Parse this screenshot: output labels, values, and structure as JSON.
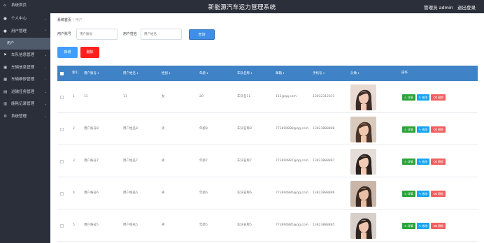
{
  "header": {
    "title": "新能源汽车运力管理系统",
    "user_label": "管理员 admin",
    "logout": "退出登录"
  },
  "sidebar": {
    "items": [
      {
        "icon": "home-icon",
        "label": "系统首页"
      },
      {
        "icon": "person-icon",
        "label": "个人中心"
      },
      {
        "icon": "users-icon",
        "label": "用户管理"
      },
      {
        "icon": "flag-icon",
        "label": "车队信息管理"
      },
      {
        "icon": "car-icon",
        "label": "车辆信息管理"
      },
      {
        "icon": "grid-icon",
        "label": "车辆维修管理"
      },
      {
        "icon": "doc-icon",
        "label": "运输任务管理"
      },
      {
        "icon": "battery-icon",
        "label": "能耗记录管理"
      },
      {
        "icon": "gear-icon",
        "label": "系统管理"
      }
    ],
    "subitem": "用户"
  },
  "breadcrumb": {
    "home": "系统首页",
    "current": "用户"
  },
  "search": {
    "label1": "用户账号",
    "placeholder1": "用户账号",
    "label2": "用户姓名",
    "placeholder2": "用户姓名",
    "query_button": "查询"
  },
  "actions": {
    "add": "新增",
    "delete": "删除"
  },
  "table": {
    "headers": [
      "索引",
      "用户账号",
      "用户姓名",
      "性别",
      "年龄",
      "车队名称",
      "邮箱",
      "手机号",
      "头像",
      "操作"
    ],
    "rows": [
      {
        "index": "1",
        "account": "11",
        "name": "11",
        "gender": "女",
        "age": "20",
        "team": "车队名11",
        "email": "111@qq.com",
        "phone": "13012312311"
      },
      {
        "index": "2",
        "account": "用户账号8",
        "name": "用户姓名8",
        "gender": "男",
        "age": "年龄8",
        "team": "车队名称8",
        "email": "773890888@qq.com",
        "phone": "13823888888"
      },
      {
        "index": "3",
        "account": "用户账号7",
        "name": "用户姓名7",
        "gender": "男",
        "age": "年龄7",
        "team": "车队名称7",
        "email": "773890887@qq.com",
        "phone": "13823888887"
      },
      {
        "index": "4",
        "account": "用户账号6",
        "name": "用户姓名6",
        "gender": "男",
        "age": "年龄6",
        "team": "车队名称6",
        "email": "773890886@qq.com",
        "phone": "13823888886"
      },
      {
        "index": "5",
        "account": "用户账号5",
        "name": "用户姓名5",
        "gender": "男",
        "age": "年龄5",
        "team": "车队名称5",
        "email": "773890885@qq.com",
        "phone": "13823888885"
      }
    ],
    "ops": {
      "detail": "详情",
      "edit": "修改",
      "delete": "删除"
    }
  },
  "colors": {
    "sidebar": "#2b2f3a",
    "table_header": "#3f82c6",
    "primary": "#409eff",
    "danger": "#ff1f1f",
    "detail": "#2aa437",
    "edit": "#1aa3f0",
    "op_delete": "#f06060"
  }
}
